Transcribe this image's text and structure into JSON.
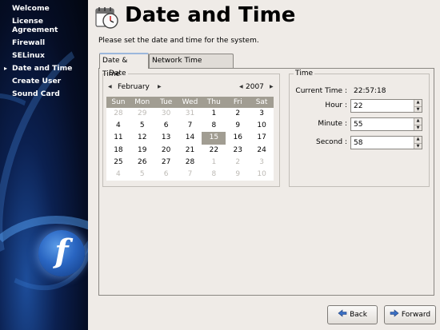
{
  "sidebar": {
    "items": [
      {
        "label": "Welcome",
        "current": false
      },
      {
        "label": "License Agreement",
        "current": false
      },
      {
        "label": "Firewall",
        "current": false
      },
      {
        "label": "SELinux",
        "current": false
      },
      {
        "label": "Date and Time",
        "current": true
      },
      {
        "label": "Create User",
        "current": false
      },
      {
        "label": "Sound Card",
        "current": false
      }
    ],
    "logo_letter": "f"
  },
  "header": {
    "title": "Date and Time",
    "icon": "clock-calendar-icon"
  },
  "intro": "Please set the date and time for the system.",
  "tabs": [
    {
      "label": "Date & Time",
      "active": true
    },
    {
      "label": "Network Time Protocol",
      "active": false
    }
  ],
  "date_section": {
    "label": "Date",
    "month": "February",
    "year": "2007",
    "weekdays": [
      "Sun",
      "Mon",
      "Tue",
      "Wed",
      "Thu",
      "Fri",
      "Sat"
    ],
    "weeks": [
      [
        "28",
        "29",
        "30",
        "31",
        "1",
        "2",
        "3"
      ],
      [
        "4",
        "5",
        "6",
        "7",
        "8",
        "9",
        "10"
      ],
      [
        "11",
        "12",
        "13",
        "14",
        "15",
        "16",
        "17"
      ],
      [
        "18",
        "19",
        "20",
        "21",
        "22",
        "23",
        "24"
      ],
      [
        "25",
        "26",
        "27",
        "28",
        "1",
        "2",
        "3"
      ],
      [
        "4",
        "5",
        "6",
        "7",
        "8",
        "9",
        "10"
      ]
    ],
    "selected_day": "15"
  },
  "time_section": {
    "label": "Time",
    "current_time_label": "Current Time :",
    "current_time": "22:57:18",
    "hour_label": "Hour :",
    "hour": "22",
    "minute_label": "Minute :",
    "minute": "55",
    "second_label": "Second :",
    "second": "58"
  },
  "buttons": {
    "back": "Back",
    "forward": "Forward"
  },
  "colors": {
    "calendar_header": "#a19d92",
    "selected_day": "#a19d92",
    "window_bg": "#efebe7"
  }
}
